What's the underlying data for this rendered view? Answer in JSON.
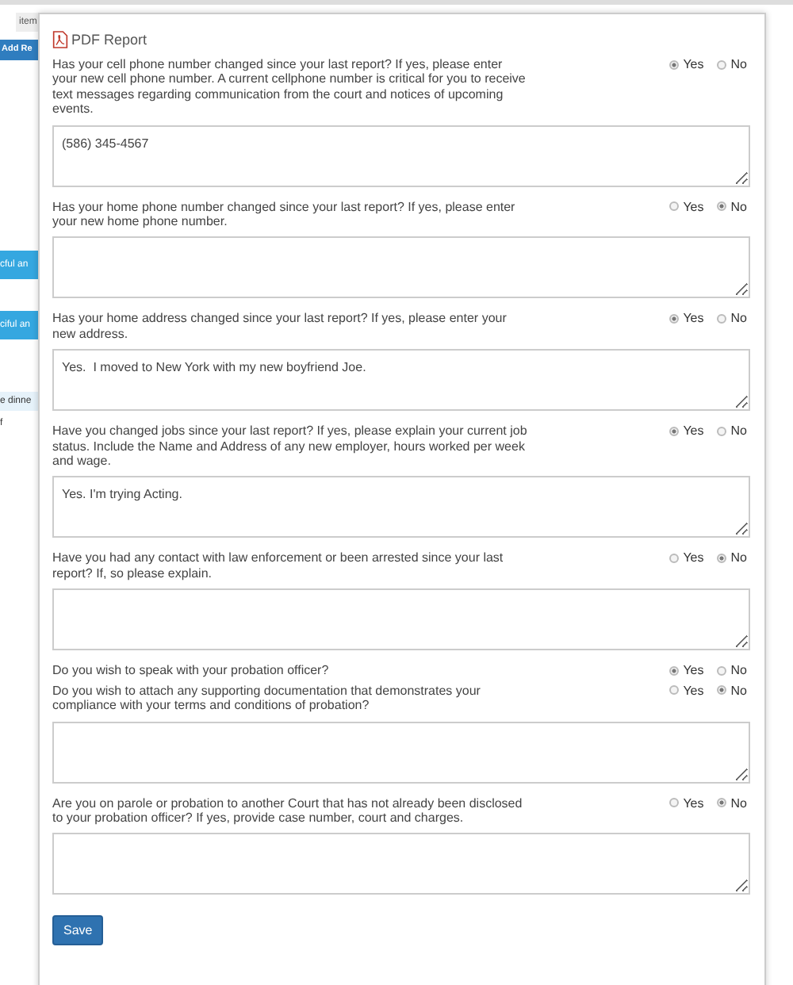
{
  "background": {
    "field_text": "item",
    "button": "Add Re",
    "items": [
      {
        "text": "cful an",
        "kind": "bar"
      },
      {
        "text": "ciful an",
        "kind": "bar"
      },
      {
        "text": "e dinne",
        "kind": "light"
      },
      {
        "text": "f",
        "kind": "plain"
      }
    ]
  },
  "dialog": {
    "title": "PDF Report",
    "save_button": "Save",
    "questions": [
      {
        "text": "Has your cell phone number changed since your last report? If yes, please enter your new cell phone number. A current cellphone number is critical for you to receive text messages regarding communication from the court and notices of upcoming events.",
        "options": [
          {
            "label": "Yes",
            "selected": true
          },
          {
            "label": "No",
            "selected": false
          }
        ],
        "kind": "with_box",
        "value": "(586) 345-4567"
      },
      {
        "text": "Has your home phone number changed since your last report? If yes, please enter your new home phone number.",
        "options": [
          {
            "label": "Yes",
            "selected": false
          },
          {
            "label": "No",
            "selected": true
          }
        ],
        "kind": "with_box"
      },
      {
        "text": "Has your home address changed since your last report? If yes, please enter your new address.",
        "options": [
          {
            "label": "Yes",
            "selected": true
          },
          {
            "label": "No",
            "selected": false
          }
        ],
        "kind": "with_box",
        "value": "Yes.  I moved to New York with my new boyfriend Joe."
      },
      {
        "text": "Have you changed jobs since your last report? If yes, please explain your current job status. Include the Name and Address of any new employer, hours worked per week and wage.",
        "options": [
          {
            "label": "Yes",
            "selected": true
          },
          {
            "label": "No",
            "selected": false
          }
        ],
        "kind": "with_box",
        "value": "Yes. I'm trying Acting."
      },
      {
        "text": "Have you had any contact with law enforcement or been arrested since your last report? If, so please explain.",
        "options": [
          {
            "label": "Yes",
            "selected": false
          },
          {
            "label": "No",
            "selected": true
          }
        ],
        "kind": "with_box"
      },
      {
        "text": "Do you wish to speak with your probation officer?",
        "options": [
          {
            "label": "Yes",
            "selected": true
          },
          {
            "label": "No",
            "selected": false
          }
        ],
        "kind": "plain"
      },
      {
        "text": "Do you wish to attach any supporting documentation that demonstrates your compliance with your terms and conditions of probation?",
        "options": [
          {
            "label": "Yes",
            "selected": false
          },
          {
            "label": "No",
            "selected": true
          }
        ],
        "kind": "with_box"
      },
      {
        "text": "Are you on parole or probation to another Court that has not already been disclosed to your probation officer? If yes, provide case number, court and charges.",
        "options": [
          {
            "label": "Yes",
            "selected": false
          },
          {
            "label": "No",
            "selected": true
          }
        ],
        "kind": "with_box"
      }
    ]
  }
}
